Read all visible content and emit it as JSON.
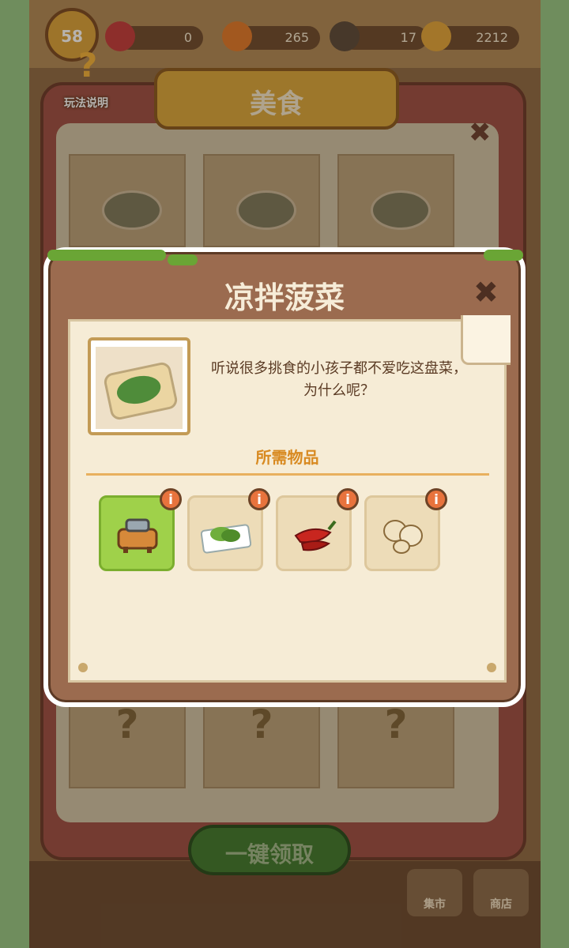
{
  "top_bar": {
    "player_level": "58",
    "gems": "0",
    "carrots": "265",
    "energy": "17",
    "coins": "2212"
  },
  "help": {
    "label": "玩法说明",
    "icon": "question-book-icon"
  },
  "food_panel": {
    "title": "美食",
    "close_icon": "close-x-icon",
    "claim_all_label": "一键领取",
    "locked_symbol": "?"
  },
  "bottom_bar": {
    "market_label": "集市",
    "shop_label": "商店"
  },
  "dialog": {
    "title": "凉拌菠菜",
    "close_icon": "close-x-icon",
    "description": "听说很多挑食的小孩子都不爱吃这盘菜，为什么呢？",
    "required_label": "所需物品",
    "info_label": "i",
    "ingredients": [
      {
        "name": "cooking-pot",
        "icon": "pot-icon",
        "highlighted": true
      },
      {
        "name": "spinach",
        "icon": "spinach-icon",
        "highlighted": false
      },
      {
        "name": "chili-pepper",
        "icon": "chili-icon",
        "highlighted": false
      },
      {
        "name": "garlic",
        "icon": "garlic-icon",
        "highlighted": false
      }
    ]
  },
  "colors": {
    "accent_green": "#9fd14a",
    "title_orange": "#d88a21",
    "info_badge": "#e8733d"
  }
}
